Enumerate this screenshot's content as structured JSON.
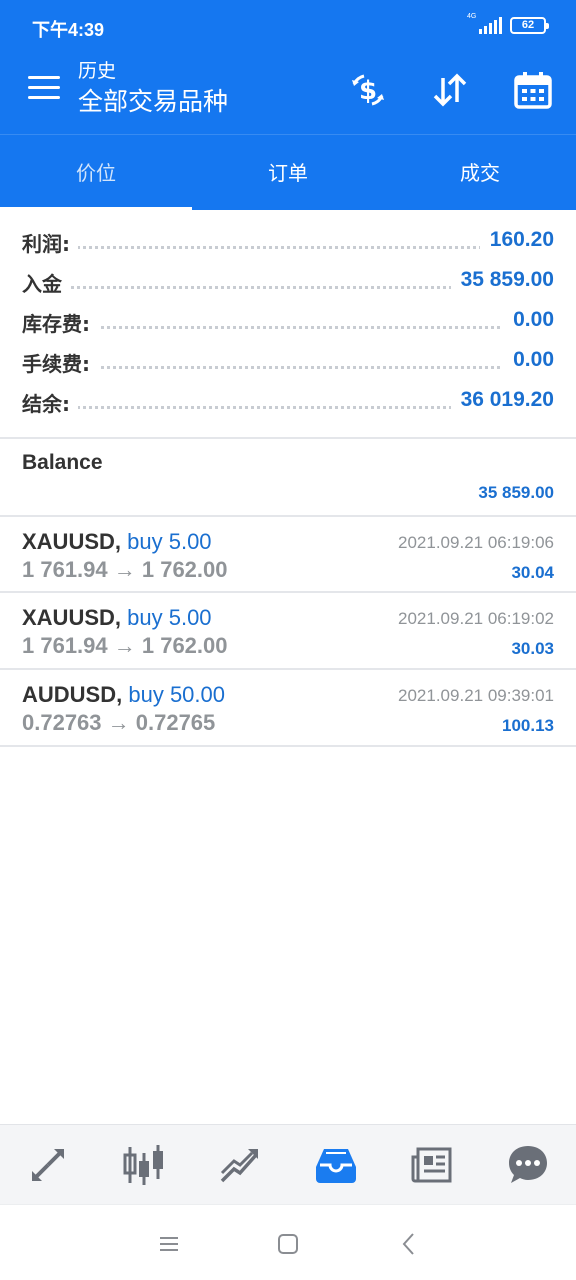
{
  "status": {
    "time": "下午4:39",
    "network": "4G",
    "battery": "62"
  },
  "header": {
    "subtitle": "历史",
    "title": "全部交易品种"
  },
  "tabs": [
    {
      "label": "价位"
    },
    {
      "label": "订单"
    },
    {
      "label": "成交"
    }
  ],
  "summary": [
    {
      "label": "利润:",
      "value": "160.20"
    },
    {
      "label": "入金",
      "value": "35 859.00"
    },
    {
      "label": "库存费:",
      "value": "0.00"
    },
    {
      "label": "手续费:",
      "value": "0.00"
    },
    {
      "label": "结余:",
      "value": "36 019.20"
    }
  ],
  "balance": {
    "label": "Balance",
    "value": "35 859.00"
  },
  "deals": [
    {
      "symbol": "XAUUSD,",
      "trade": "buy 5.00",
      "prices": "1 761.94 → 1 762.00",
      "time": "2021.09.21 06:19:06",
      "profit": "30.04"
    },
    {
      "symbol": "XAUUSD,",
      "trade": "buy 5.00",
      "prices": "1 761.94 → 1 762.00",
      "time": "2021.09.21 06:19:02",
      "profit": "30.03"
    },
    {
      "symbol": "AUDUSD,",
      "trade": "buy 50.00",
      "prices": "0.72763 → 0.72765",
      "time": "2021.09.21 09:39:01",
      "profit": "100.13"
    }
  ],
  "icons": {
    "menu": "hamburger-icon",
    "currency": "currency-exchange-icon",
    "sort": "sort-icon",
    "calendar": "calendar-icon",
    "nav": [
      "quotes-icon",
      "chart-icon",
      "trade-icon",
      "history-icon",
      "news-icon",
      "chat-icon"
    ]
  },
  "colors": {
    "primary": "#1577f0",
    "value": "#1a6fd0",
    "muted": "#909498",
    "active_nav": "#1a7cf0"
  }
}
